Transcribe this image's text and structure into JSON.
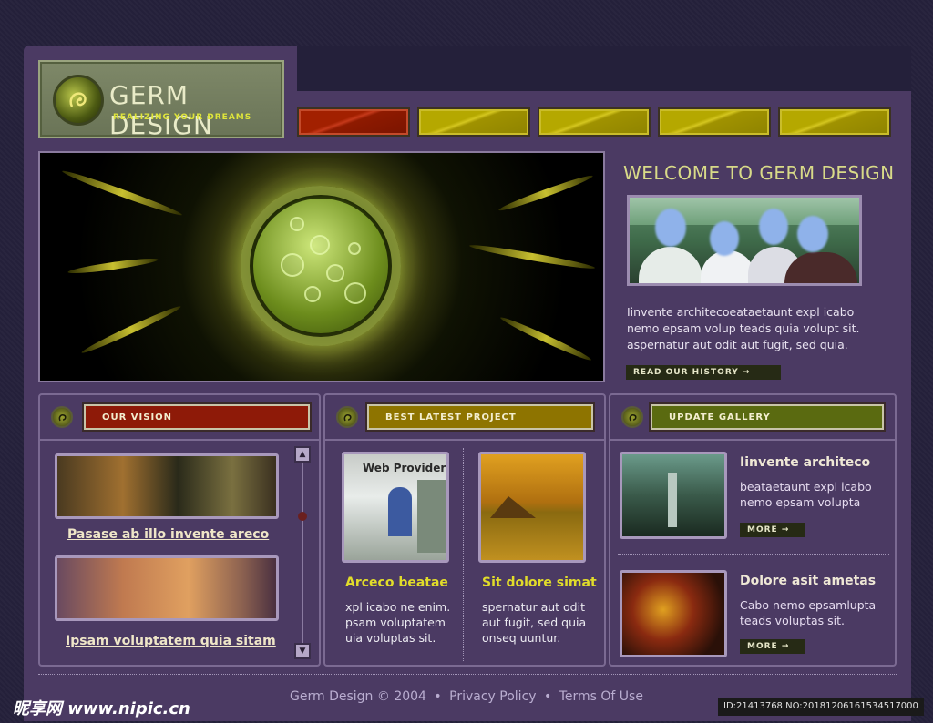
{
  "logo": {
    "title": "GERM DESIGN",
    "tagline": "REALIZING YOUR DREAMS"
  },
  "nav": {
    "items": [
      "",
      "",
      "",
      "",
      ""
    ]
  },
  "welcome": {
    "title": "WELCOME TO GERM DESIGN",
    "text": "Iinvente architecoeataetaunt expl icabo nemo epsam volup teads quia volupt sit. aspernatur aut odit aut fugit, sed quia.",
    "button": "READ OUR HISTORY →"
  },
  "vision": {
    "label": "OUR VISION",
    "items": [
      {
        "link": "Pasase ab illo invente areco"
      },
      {
        "link": "Ipsam voluptatem quia sitam"
      }
    ],
    "scroll_up": "▲",
    "scroll_down": "▼"
  },
  "projects": {
    "label": "BEST LATEST PROJECT",
    "screen_text": "Web Provider",
    "items": [
      {
        "title": "Arceco beatae",
        "text": "xpl icabo ne enim. psam voluptatem uia voluptas sit."
      },
      {
        "title": "Sit dolore simat",
        "text": "spernatur aut odit aut fugit, sed quia onseq uuntur."
      }
    ]
  },
  "gallery": {
    "label": "UPDATE GALLERY",
    "items": [
      {
        "title": "Iinvente architeco",
        "text": "beataetaunt expl icabo nemo epsam volupta",
        "button": "MORE →"
      },
      {
        "title": "Dolore asit ametas",
        "text": "Cabo nemo epsamlupta teads voluptas sit.",
        "button": "MORE →"
      }
    ]
  },
  "footer": {
    "copyright": "Germ Design © 2004",
    "privacy": "Privacy Policy",
    "terms": "Terms Of Use",
    "separator": "•"
  },
  "watermark": {
    "left": "昵享网 www.nipic.cn",
    "right": "ID:21413768 NO:20181206161534517000"
  },
  "colors": {
    "background": "#24203a",
    "panel": "#4b3a63",
    "accent_yellow": "#d4c61f",
    "accent_red": "#a22000"
  }
}
